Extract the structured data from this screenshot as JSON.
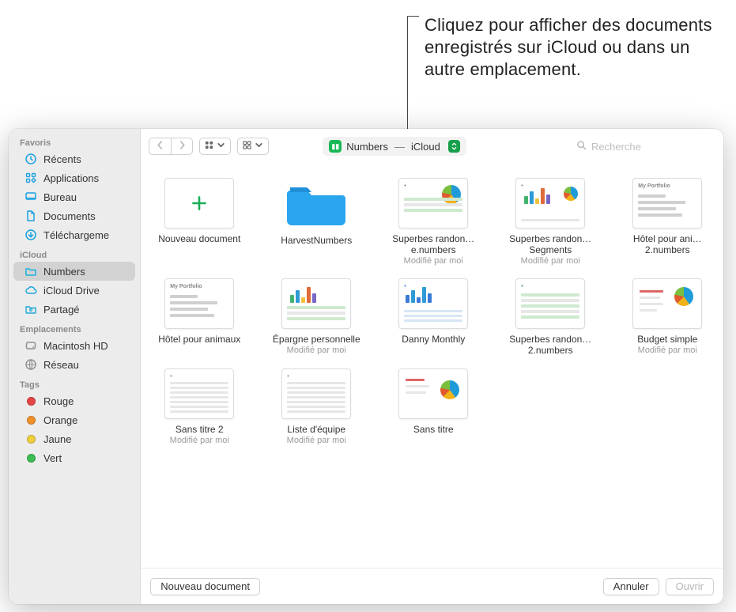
{
  "annotation": {
    "text": "Cliquez pour afficher des documents enregistrés sur iCloud ou dans un autre emplacement."
  },
  "sidebar": {
    "sections": [
      {
        "header": "Favoris",
        "items": [
          {
            "id": "recents",
            "label": "Récents",
            "icon": "clock",
            "color": "#1aa1e0"
          },
          {
            "id": "apps",
            "label": "Applications",
            "icon": "apps",
            "color": "#1aa1e0"
          },
          {
            "id": "desktop",
            "label": "Bureau",
            "icon": "desktop",
            "color": "#1aa1e0"
          },
          {
            "id": "documents",
            "label": "Documents",
            "icon": "doc",
            "color": "#1aa1e0"
          },
          {
            "id": "downloads",
            "label": "Téléchargeme",
            "icon": "download",
            "color": "#1aa1e0"
          }
        ]
      },
      {
        "header": "iCloud",
        "items": [
          {
            "id": "numbers",
            "label": "Numbers",
            "icon": "folder",
            "color": "#19b1e0",
            "selected": true
          },
          {
            "id": "iclouddrive",
            "label": "iCloud Drive",
            "icon": "cloud",
            "color": "#1aa6d6"
          },
          {
            "id": "shared",
            "label": "Partagé",
            "icon": "shared",
            "color": "#1aa6d6"
          }
        ]
      },
      {
        "header": "Emplacements",
        "items": [
          {
            "id": "macintoshhd",
            "label": "Macintosh HD",
            "icon": "disk",
            "color": "#8e8e8e"
          },
          {
            "id": "network",
            "label": "Réseau",
            "icon": "network",
            "color": "#8e8e8e"
          }
        ]
      },
      {
        "header": "Tags",
        "items": [
          {
            "id": "tag-red",
            "label": "Rouge",
            "icon": "tag",
            "color": "#e64545"
          },
          {
            "id": "tag-orange",
            "label": "Orange",
            "icon": "tag",
            "color": "#f0902b"
          },
          {
            "id": "tag-yellow",
            "label": "Jaune",
            "icon": "tag",
            "color": "#efcf3c"
          },
          {
            "id": "tag-green",
            "label": "Vert",
            "icon": "tag",
            "color": "#3bbd53"
          }
        ]
      }
    ]
  },
  "toolbar": {
    "location_app": "Numbers",
    "location_place": "iCloud",
    "search_placeholder": "Recherche"
  },
  "grid": {
    "items": [
      {
        "kind": "new",
        "title": "Nouveau document"
      },
      {
        "kind": "folder",
        "title": "HarvestNumbers"
      },
      {
        "kind": "file",
        "title": "Superbes randon…e.numbers",
        "subtitle": "Modifié par moi",
        "thumb": "chart"
      },
      {
        "kind": "file",
        "title": "Superbes randon…Segments",
        "subtitle": "Modifié par moi",
        "thumb": "bars"
      },
      {
        "kind": "file",
        "title": "Hôtel pour ani…2.numbers",
        "thumb": "text"
      },
      {
        "kind": "file",
        "title": "Hôtel pour animaux",
        "thumb": "text"
      },
      {
        "kind": "file",
        "title": "Épargne personnelle",
        "subtitle": "Modifié par moi",
        "thumb": "bars2"
      },
      {
        "kind": "file",
        "title": "Danny Monthly",
        "thumb": "bars3"
      },
      {
        "kind": "file",
        "title": "Superbes randon…2.numbers",
        "thumb": "table"
      },
      {
        "kind": "file",
        "title": "Budget simple",
        "subtitle": "Modifié par moi",
        "thumb": "pie"
      },
      {
        "kind": "file",
        "title": "Sans titre 2",
        "subtitle": "Modifié par moi",
        "thumb": "list"
      },
      {
        "kind": "file",
        "title": "Liste d'équipe",
        "subtitle": "Modifié par moi",
        "thumb": "list"
      },
      {
        "kind": "file",
        "title": "Sans titre",
        "thumb": "pie2"
      }
    ]
  },
  "footer": {
    "new_doc": "Nouveau document",
    "cancel": "Annuler",
    "open": "Ouvrir"
  }
}
